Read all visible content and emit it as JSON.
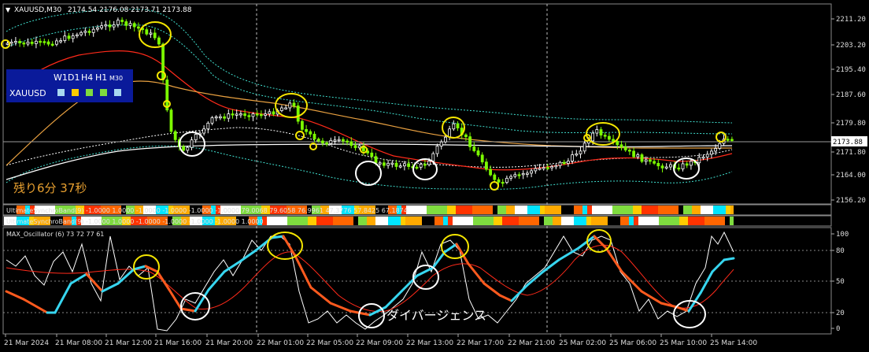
{
  "window": {
    "title": "XAUUSD,M30",
    "ohlc": "2174.54 2176.08 2173.71 2173.88",
    "current_price": "2173.88"
  },
  "timeframe_panel": {
    "timeframes": [
      "W1",
      "D1",
      "H4",
      "H1",
      "M30"
    ],
    "symbol": "XAUUSD",
    "status_colors": [
      "#a8d8f0",
      "#ffcc00",
      "#7fdc3f",
      "#7fdc3f",
      "#a8d8f0"
    ]
  },
  "countdown_text": "残り6分 37秒",
  "price_axis": {
    "ticks": [
      "2211.20",
      "2203.20",
      "2195.40",
      "2187.60",
      "2179.80",
      "2171.80",
      "2164.00",
      "2156.20"
    ]
  },
  "indicator_labels": {
    "band1": "UltimateSynchroBand(9) -1.0000 1.0000 -1.0000 -1.0000 -1.0000 -1.0000 79.0068 79.6058 76.9961 47.3776 57.8425 67.1874",
    "band2": "UltimateSynchroBand(9) -1.0000 1.0000 -1.0000 -1.0000 -1.0000 -1.0000 1.0000",
    "oscillator": "MAX_Oscillator (6) 73 72 77 61"
  },
  "oscillator_axis": {
    "ticks": [
      "100",
      "80",
      "50",
      "20",
      "0"
    ]
  },
  "annotation_text": "ダイバージェンス",
  "time_axis": {
    "ticks": [
      "21 Mar 2024",
      "21 Mar 08:00",
      "21 Mar 12:00",
      "21 Mar 16:00",
      "21 Mar 20:00",
      "22 Mar 01:00",
      "22 Mar 05:00",
      "22 Mar 09:00",
      "22 Mar 13:00",
      "22 Mar 17:00",
      "22 Mar 21:00",
      "25 Mar 02:00",
      "25 Mar 06:00",
      "25 Mar 10:00",
      "25 Mar 14:00"
    ]
  },
  "colors": {
    "bull_candle": "#ffffff",
    "bear_candle": "#7cfc00",
    "ma_red": "#ff2a1a",
    "ma_gold": "#e8a040",
    "ma_white": "#ffffff",
    "band_cyan": "#40e0d0",
    "circle_yellow": "#f5e600",
    "circle_white": "#ffffff",
    "osc_cyan": "#37d6f0",
    "osc_orange": "#ff5a1e"
  }
}
